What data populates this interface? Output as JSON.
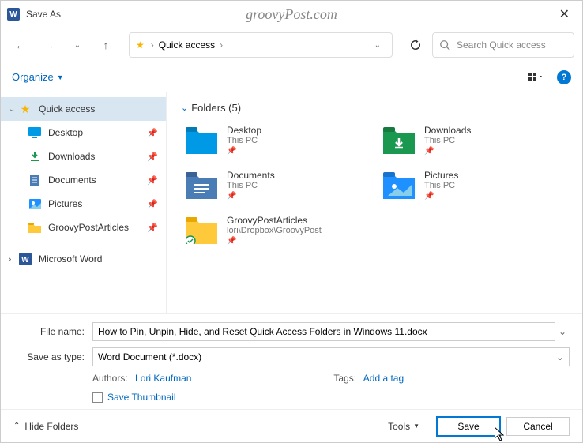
{
  "window": {
    "title": "Save As"
  },
  "watermark": "groovyPost.com",
  "breadcrumb": {
    "label": "Quick access"
  },
  "search": {
    "placeholder": "Search Quick access"
  },
  "toolbar": {
    "organize": "Organize"
  },
  "sidebar": {
    "quickaccess": {
      "label": "Quick access"
    },
    "items": [
      {
        "label": "Desktop"
      },
      {
        "label": "Downloads"
      },
      {
        "label": "Documents"
      },
      {
        "label": "Pictures"
      },
      {
        "label": "GroovyPostArticles"
      }
    ],
    "msword": {
      "label": "Microsoft Word"
    }
  },
  "content": {
    "group_header": "Folders (5)",
    "folders": [
      {
        "name": "Desktop",
        "sub": "This PC"
      },
      {
        "name": "Downloads",
        "sub": "This PC"
      },
      {
        "name": "Documents",
        "sub": "This PC"
      },
      {
        "name": "Pictures",
        "sub": "This PC"
      },
      {
        "name": "GroovyPostArticles",
        "sub": "lori\\Dropbox\\GroovyPost"
      }
    ]
  },
  "form": {
    "filename_label": "File name:",
    "filename_value": "How to Pin, Unpin, Hide, and Reset Quick Access Folders in Windows 11.docx",
    "savetype_label": "Save as type:",
    "savetype_value": "Word Document (*.docx)",
    "authors_label": "Authors:",
    "authors_value": "Lori Kaufman",
    "tags_label": "Tags:",
    "tags_value": "Add a tag",
    "save_thumbnail": "Save Thumbnail"
  },
  "footer": {
    "hide_folders": "Hide Folders",
    "tools": "Tools",
    "save": "Save",
    "cancel": "Cancel"
  }
}
